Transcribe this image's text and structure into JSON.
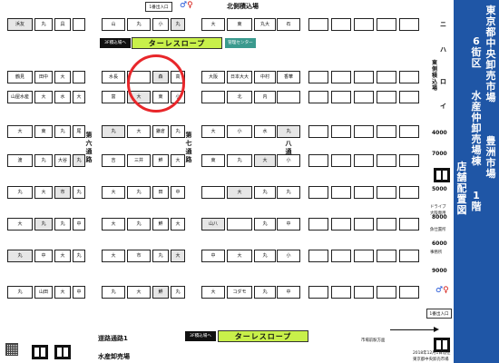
{
  "map": {
    "north_label": "北側積込場",
    "entrance_top": "1番出入口",
    "entrance_bottom": "1番出入口",
    "slope_top": "ターレスロープ",
    "slope_bottom": "ターレスロープ",
    "load_badge_top": "3F積込場へ",
    "load_badge_bottom": "3F積込場へ",
    "center_tag": "管理センター",
    "east_load": "東側積込場",
    "aisles": [
      "第六通路",
      "第七通路",
      "第八通路"
    ],
    "row_letters": [
      "ニ",
      "ハ",
      "ロ",
      "イ"
    ],
    "row_numbers": [
      "4000",
      "5000",
      "6000",
      "7000",
      "8000",
      "9000"
    ],
    "bottom_road": "道路通路1",
    "bottom_dest": "水産卸売場",
    "station_exit": "市場前駅方面",
    "side_right": [
      "ドライブ",
      "大阪専用",
      "魚仕置所",
      "事務所"
    ],
    "footer_date": "2018年12月1日現在",
    "footer_org": "東京都中央卸売市場"
  },
  "stalls": [
    {
      "r": 0,
      "c": 0,
      "label": "浜友"
    },
    {
      "r": 0,
      "c": 1,
      "label": "丸"
    },
    {
      "r": 0,
      "c": 2,
      "label": "具"
    },
    {
      "r": 0,
      "c": 3,
      "label": ""
    },
    {
      "r": 0,
      "c": 4,
      "label": "山"
    },
    {
      "r": 0,
      "c": 5,
      "label": "丸"
    },
    {
      "r": 0,
      "c": 6,
      "label": "小"
    },
    {
      "r": 0,
      "c": 7,
      "label": "丸"
    },
    {
      "r": 0,
      "c": 8,
      "label": "大"
    },
    {
      "r": 0,
      "c": 9,
      "label": "東"
    },
    {
      "r": 0,
      "c": 10,
      "label": "丸大"
    },
    {
      "r": 0,
      "c": 11,
      "label": "石"
    },
    {
      "r": 1,
      "c": 0,
      "label": "鶴見"
    },
    {
      "r": 1,
      "c": 1,
      "label": "田中"
    },
    {
      "r": 1,
      "c": 2,
      "label": "大"
    },
    {
      "r": 1,
      "c": 3,
      "label": ""
    },
    {
      "r": 1,
      "c": 4,
      "label": "水長"
    },
    {
      "r": 1,
      "c": 5,
      "label": ""
    },
    {
      "r": 1,
      "c": 6,
      "label": "森"
    },
    {
      "r": 1,
      "c": 7,
      "label": "高"
    },
    {
      "r": 1,
      "c": 8,
      "label": "大阪"
    },
    {
      "r": 1,
      "c": 9,
      "label": "日本大大"
    },
    {
      "r": 1,
      "c": 10,
      "label": "中村"
    },
    {
      "r": 1,
      "c": 11,
      "label": "香華"
    },
    {
      "r": 2,
      "c": 0,
      "label": "山屋水産"
    },
    {
      "r": 2,
      "c": 1,
      "label": "大"
    },
    {
      "r": 2,
      "c": 2,
      "label": "水"
    },
    {
      "r": 2,
      "c": 3,
      "label": "大"
    },
    {
      "r": 2,
      "c": 4,
      "label": "富"
    },
    {
      "r": 2,
      "c": 5,
      "label": "大"
    },
    {
      "r": 2,
      "c": 6,
      "label": "東"
    },
    {
      "r": 2,
      "c": 7,
      "label": "小"
    },
    {
      "r": 2,
      "c": 8,
      "label": ""
    },
    {
      "r": 2,
      "c": 9,
      "label": "北"
    },
    {
      "r": 2,
      "c": 10,
      "label": "内"
    },
    {
      "r": 2,
      "c": 11,
      "label": ""
    },
    {
      "r": 3,
      "c": 0,
      "label": "大"
    },
    {
      "r": 3,
      "c": 1,
      "label": "東"
    },
    {
      "r": 3,
      "c": 2,
      "label": "丸"
    },
    {
      "r": 3,
      "c": 3,
      "label": "尾"
    },
    {
      "r": 3,
      "c": 4,
      "label": "丸"
    },
    {
      "r": 3,
      "c": 5,
      "label": "大"
    },
    {
      "r": 3,
      "c": 6,
      "label": "鎌倉"
    },
    {
      "r": 3,
      "c": 7,
      "label": "丸"
    },
    {
      "r": 3,
      "c": 8,
      "label": "大"
    },
    {
      "r": 3,
      "c": 9,
      "label": "小"
    },
    {
      "r": 3,
      "c": 10,
      "label": "水"
    },
    {
      "r": 3,
      "c": 11,
      "label": "丸"
    },
    {
      "r": 4,
      "c": 0,
      "label": "渡"
    },
    {
      "r": 4,
      "c": 1,
      "label": "丸"
    },
    {
      "r": 4,
      "c": 2,
      "label": "大谷"
    },
    {
      "r": 4,
      "c": 3,
      "label": "丸"
    },
    {
      "r": 4,
      "c": 4,
      "label": "吉"
    },
    {
      "r": 4,
      "c": 5,
      "label": "三井"
    },
    {
      "r": 4,
      "c": 6,
      "label": "鮮"
    },
    {
      "r": 4,
      "c": 7,
      "label": "大"
    },
    {
      "r": 4,
      "c": 8,
      "label": "東"
    },
    {
      "r": 4,
      "c": 9,
      "label": "丸"
    },
    {
      "r": 4,
      "c": 10,
      "label": "大"
    },
    {
      "r": 4,
      "c": 11,
      "label": "小"
    },
    {
      "r": 5,
      "c": 0,
      "label": "丸"
    },
    {
      "r": 5,
      "c": 1,
      "label": "大"
    },
    {
      "r": 5,
      "c": 2,
      "label": "市"
    },
    {
      "r": 5,
      "c": 3,
      "label": "丸"
    },
    {
      "r": 5,
      "c": 4,
      "label": "大"
    },
    {
      "r": 5,
      "c": 5,
      "label": "丸"
    },
    {
      "r": 5,
      "c": 6,
      "label": "田"
    },
    {
      "r": 5,
      "c": 7,
      "label": "中"
    },
    {
      "r": 5,
      "c": 8,
      "label": ""
    },
    {
      "r": 5,
      "c": 9,
      "label": "大"
    },
    {
      "r": 5,
      "c": 10,
      "label": "丸"
    },
    {
      "r": 5,
      "c": 11,
      "label": "丸"
    },
    {
      "r": 6,
      "c": 0,
      "label": "大"
    },
    {
      "r": 6,
      "c": 1,
      "label": "丸"
    },
    {
      "r": 6,
      "c": 2,
      "label": "丸"
    },
    {
      "r": 6,
      "c": 3,
      "label": "中"
    },
    {
      "r": 6,
      "c": 4,
      "label": "大"
    },
    {
      "r": 6,
      "c": 5,
      "label": "丸"
    },
    {
      "r": 6,
      "c": 6,
      "label": "鮮"
    },
    {
      "r": 6,
      "c": 7,
      "label": "大"
    },
    {
      "r": 6,
      "c": 8,
      "label": "山八"
    },
    {
      "r": 6,
      "c": 9,
      "label": ""
    },
    {
      "r": 6,
      "c": 10,
      "label": "丸"
    },
    {
      "r": 6,
      "c": 11,
      "label": "中"
    },
    {
      "r": 7,
      "c": 0,
      "label": "丸"
    },
    {
      "r": 7,
      "c": 1,
      "label": "中"
    },
    {
      "r": 7,
      "c": 2,
      "label": "大"
    },
    {
      "r": 7,
      "c": 3,
      "label": "丸"
    },
    {
      "r": 7,
      "c": 4,
      "label": "大"
    },
    {
      "r": 7,
      "c": 5,
      "label": "市"
    },
    {
      "r": 7,
      "c": 6,
      "label": "丸"
    },
    {
      "r": 7,
      "c": 7,
      "label": "大"
    },
    {
      "r": 7,
      "c": 8,
      "label": "中"
    },
    {
      "r": 7,
      "c": 9,
      "label": "大"
    },
    {
      "r": 7,
      "c": 10,
      "label": "丸"
    },
    {
      "r": 7,
      "c": 11,
      "label": "小"
    },
    {
      "r": 8,
      "c": 0,
      "label": "丸"
    },
    {
      "r": 8,
      "c": 1,
      "label": "山田"
    },
    {
      "r": 8,
      "c": 2,
      "label": "大"
    },
    {
      "r": 8,
      "c": 3,
      "label": "中"
    },
    {
      "r": 8,
      "c": 4,
      "label": "丸"
    },
    {
      "r": 8,
      "c": 5,
      "label": "大"
    },
    {
      "r": 8,
      "c": 6,
      "label": "鮮"
    },
    {
      "r": 8,
      "c": 7,
      "label": "丸"
    },
    {
      "r": 8,
      "c": 8,
      "label": "大"
    },
    {
      "r": 8,
      "c": 9,
      "label": "コダモ"
    },
    {
      "r": 8,
      "c": 10,
      "label": "丸"
    },
    {
      "r": 8,
      "c": 11,
      "label": "中"
    }
  ],
  "title": {
    "lines": [
      "東京都中央卸売市場",
      "豊洲市場",
      "6街区",
      "水産仲卸売場棟",
      "1階",
      "店舗配置図"
    ]
  },
  "colors": {
    "slope": "#c8f04a",
    "title_bg": "#1f56a6",
    "highlight": "#e8262a",
    "center": "#3a9a8e"
  }
}
